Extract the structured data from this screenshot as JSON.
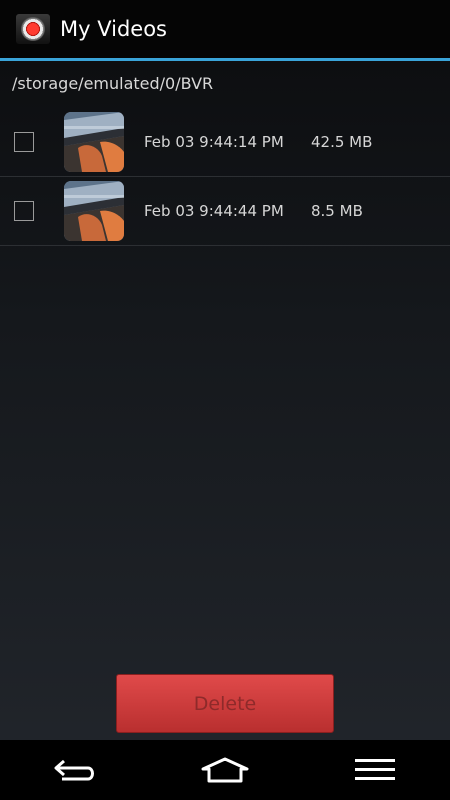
{
  "app": {
    "title": "My Videos",
    "icon": "record-icon",
    "accent_color": "#3aa4d9"
  },
  "path": "/storage/emulated/0/BVR",
  "files": [
    {
      "date": "Feb 03 9:44:14 PM",
      "size": "42.5 MB",
      "checked": false
    },
    {
      "date": "Feb 03 9:44:44 PM",
      "size": "8.5 MB",
      "checked": false
    }
  ],
  "actions": {
    "delete_label": "Delete",
    "delete_color": "#d83c3c"
  },
  "nav": {
    "back_icon": "back-icon",
    "home_icon": "home-icon",
    "menu_icon": "menu-icon"
  }
}
